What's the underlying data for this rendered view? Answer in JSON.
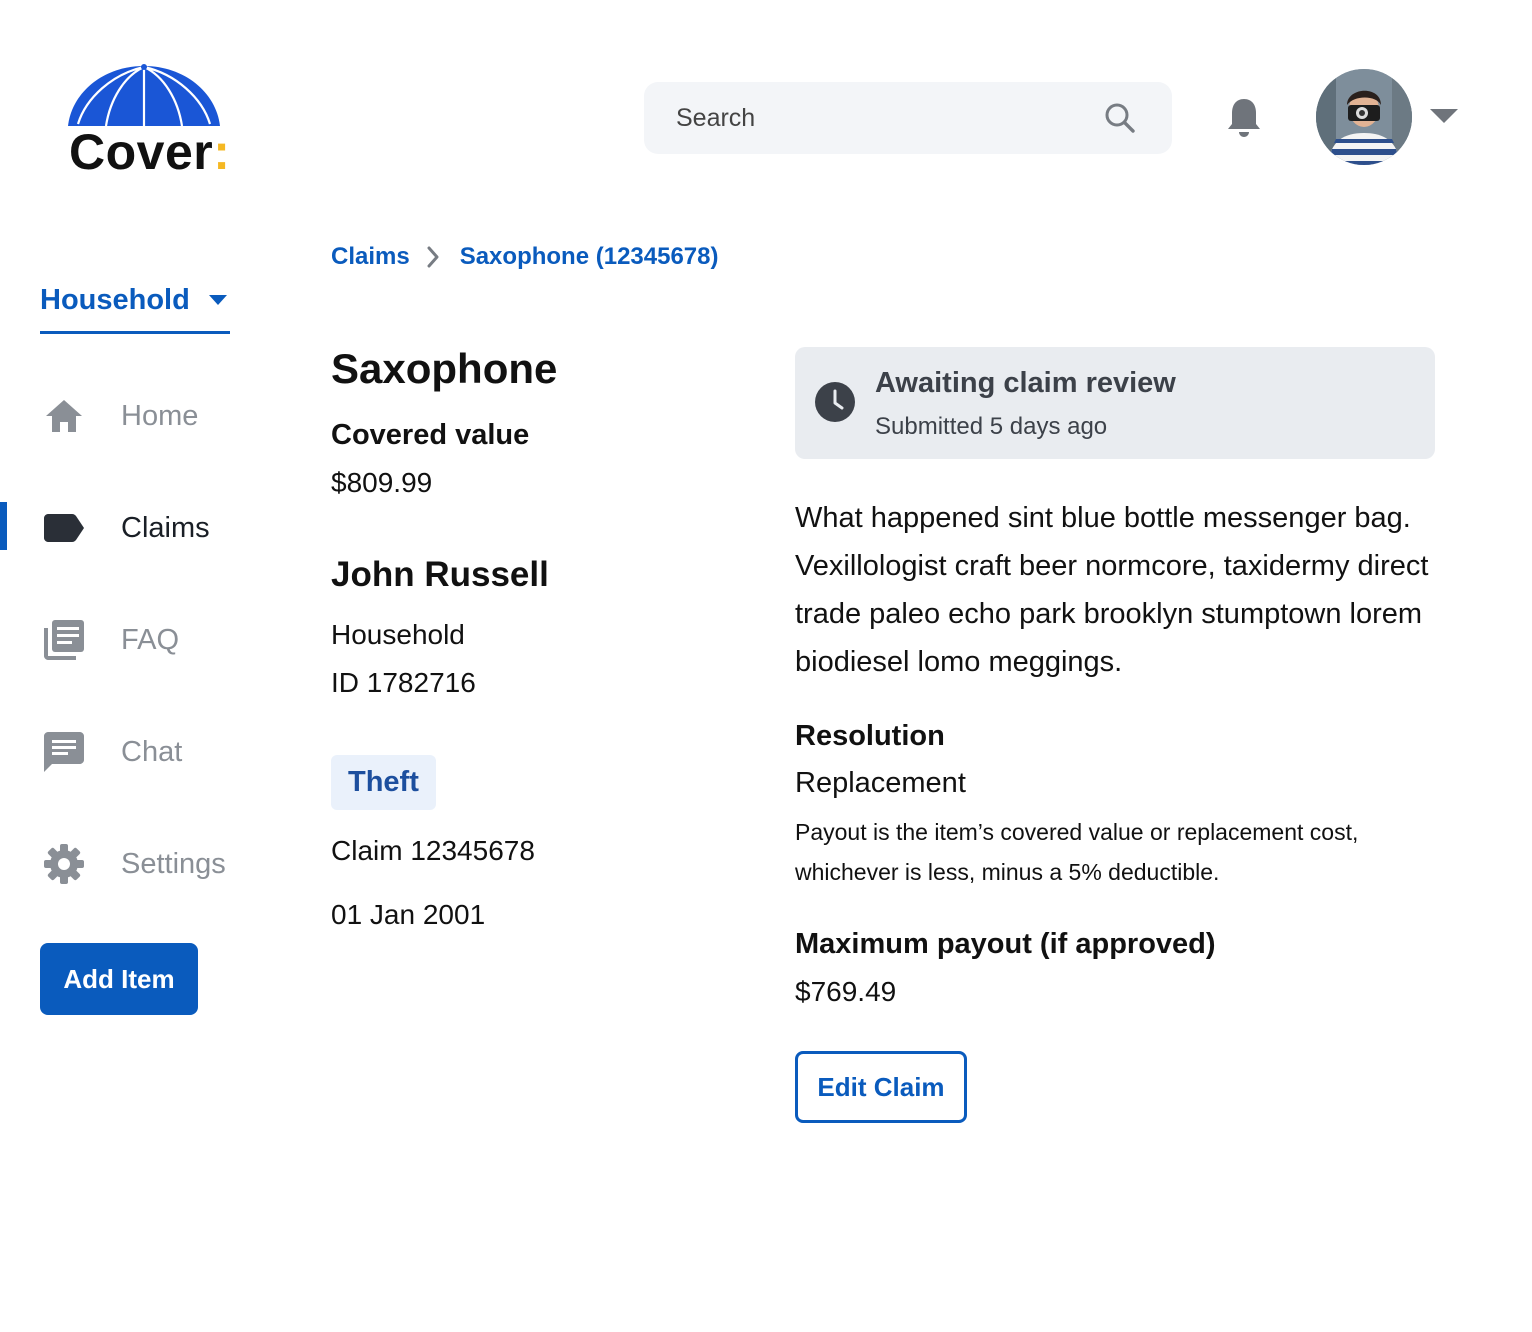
{
  "brand": {
    "name": "Cover",
    "colon": ":",
    "colors": {
      "primary": "#0a5bbd",
      "umbrella": "#1a56d6",
      "accent": "#f5b823"
    }
  },
  "header": {
    "search": {
      "placeholder": "Search",
      "value": "",
      "icon": "search-icon"
    },
    "notifications_icon": "bell-icon",
    "avatar_caret_icon": "chevron-down-icon"
  },
  "sidebar": {
    "policy_label": "Household",
    "items": [
      {
        "label": "Home",
        "icon": "home-icon",
        "active": false
      },
      {
        "label": "Claims",
        "icon": "tag-icon",
        "active": true
      },
      {
        "label": "FAQ",
        "icon": "library-icon",
        "active": false
      },
      {
        "label": "Chat",
        "icon": "chat-icon",
        "active": false
      },
      {
        "label": "Settings",
        "icon": "gear-icon",
        "active": false
      }
    ],
    "add_button_label": "Add Item"
  },
  "breadcrumb": {
    "parent": "Claims",
    "current": "Saxophone (12345678)"
  },
  "item": {
    "title": "Saxophone",
    "covered_value_label": "Covered value",
    "covered_value": "$809.99",
    "owner_name": "John Russell",
    "policy_type": "Household",
    "policy_id": "ID 1782716",
    "claim_tag": "Theft",
    "claim_number": "Claim 12345678",
    "claim_date": "01 Jan 2001"
  },
  "status": {
    "title": "Awaiting claim review",
    "subtitle": "Submitted 5 days ago",
    "icon": "clock-icon"
  },
  "claim": {
    "description": "What happened sint blue bottle messenger bag. Vexillologist craft beer normcore, taxidermy direct trade paleo echo park brooklyn stumptown lorem biodiesel lomo meggings.",
    "resolution_label": "Resolution",
    "resolution_value": "Replacement",
    "resolution_note": "Payout is the item’s covered value or replacement cost, whichever is less, minus a 5% deductible.",
    "max_payout_label": "Maximum payout (if approved)",
    "max_payout_value": "$769.49",
    "edit_button_label": "Edit Claim"
  }
}
